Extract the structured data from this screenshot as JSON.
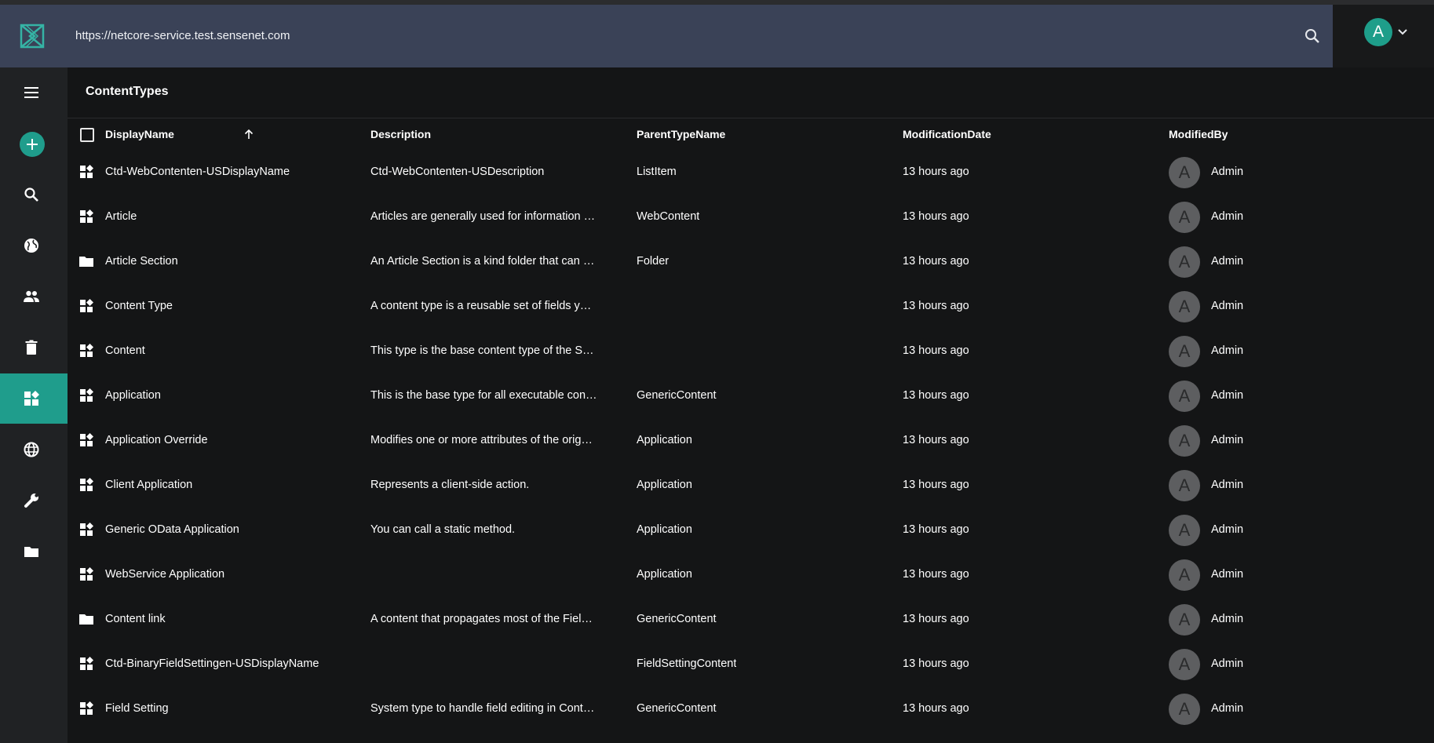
{
  "header": {
    "url": "https://netcore-service.test.sensenet.com",
    "user_initial": "A"
  },
  "sidebar": {
    "items": [
      {
        "icon": "menu-icon"
      },
      {
        "icon": "add-icon"
      },
      {
        "icon": "search-icon"
      },
      {
        "icon": "public-icon"
      },
      {
        "icon": "people-icon"
      },
      {
        "icon": "trash-icon"
      },
      {
        "icon": "content-types-icon",
        "active": true
      },
      {
        "icon": "globe-icon"
      },
      {
        "icon": "wrench-icon"
      },
      {
        "icon": "folder-icon"
      }
    ]
  },
  "page": {
    "title": "ContentTypes"
  },
  "table": {
    "columns": [
      "DisplayName",
      "Description",
      "ParentTypeName",
      "ModificationDate",
      "ModifiedBy"
    ],
    "rows": [
      {
        "icon": "content-type-icon",
        "name": "Ctd-WebContenten-USDisplayName",
        "description": "Ctd-WebContenten-USDescription",
        "parent": "ListItem",
        "date": "13 hours ago",
        "avatar": "A",
        "by": "Admin"
      },
      {
        "icon": "content-type-icon",
        "name": "Article",
        "description": "Articles are generally used for information …",
        "parent": "WebContent",
        "date": "13 hours ago",
        "avatar": "A",
        "by": "Admin"
      },
      {
        "icon": "folder-icon",
        "name": "Article Section",
        "description": "An Article Section is a kind folder that can …",
        "parent": "Folder",
        "date": "13 hours ago",
        "avatar": "A",
        "by": "Admin"
      },
      {
        "icon": "content-type-icon",
        "name": "Content Type",
        "description": "A content type is a reusable set of fields y…",
        "parent": "",
        "date": "13 hours ago",
        "avatar": "A",
        "by": "Admin"
      },
      {
        "icon": "content-type-icon",
        "name": "Content",
        "description": "This type is the base content type of the S…",
        "parent": "",
        "date": "13 hours ago",
        "avatar": "A",
        "by": "Admin"
      },
      {
        "icon": "content-type-icon",
        "name": "Application",
        "description": "This is the base type for all executable con…",
        "parent": "GenericContent",
        "date": "13 hours ago",
        "avatar": "A",
        "by": "Admin"
      },
      {
        "icon": "content-type-icon",
        "name": "Application Override",
        "description": "Modifies one or more attributes of the orig…",
        "parent": "Application",
        "date": "13 hours ago",
        "avatar": "A",
        "by": "Admin"
      },
      {
        "icon": "content-type-icon",
        "name": "Client Application",
        "description": "Represents a client-side action.",
        "parent": "Application",
        "date": "13 hours ago",
        "avatar": "A",
        "by": "Admin"
      },
      {
        "icon": "content-type-icon",
        "name": "Generic OData Application",
        "description": "You can call a static method.",
        "parent": "Application",
        "date": "13 hours ago",
        "avatar": "A",
        "by": "Admin"
      },
      {
        "icon": "content-type-icon",
        "name": "WebService Application",
        "description": "",
        "parent": "Application",
        "date": "13 hours ago",
        "avatar": "A",
        "by": "Admin"
      },
      {
        "icon": "folder-icon",
        "name": "Content link",
        "description": "A content that propagates most of the Fiel…",
        "parent": "GenericContent",
        "date": "13 hours ago",
        "avatar": "A",
        "by": "Admin"
      },
      {
        "icon": "content-type-icon",
        "name": "Ctd-BinaryFieldSettingen-USDisplayName",
        "description": "",
        "parent": "FieldSettingContent",
        "date": "13 hours ago",
        "avatar": "A",
        "by": "Admin"
      },
      {
        "icon": "content-type-icon",
        "name": "Field Setting",
        "description": "System type to handle field editing in Cont…",
        "parent": "GenericContent",
        "date": "13 hours ago",
        "avatar": "A",
        "by": "Admin"
      }
    ]
  },
  "colors": {
    "accent": "#1f9d8c",
    "header": "#3a4257",
    "background": "#141516",
    "sidebar": "#202224"
  }
}
